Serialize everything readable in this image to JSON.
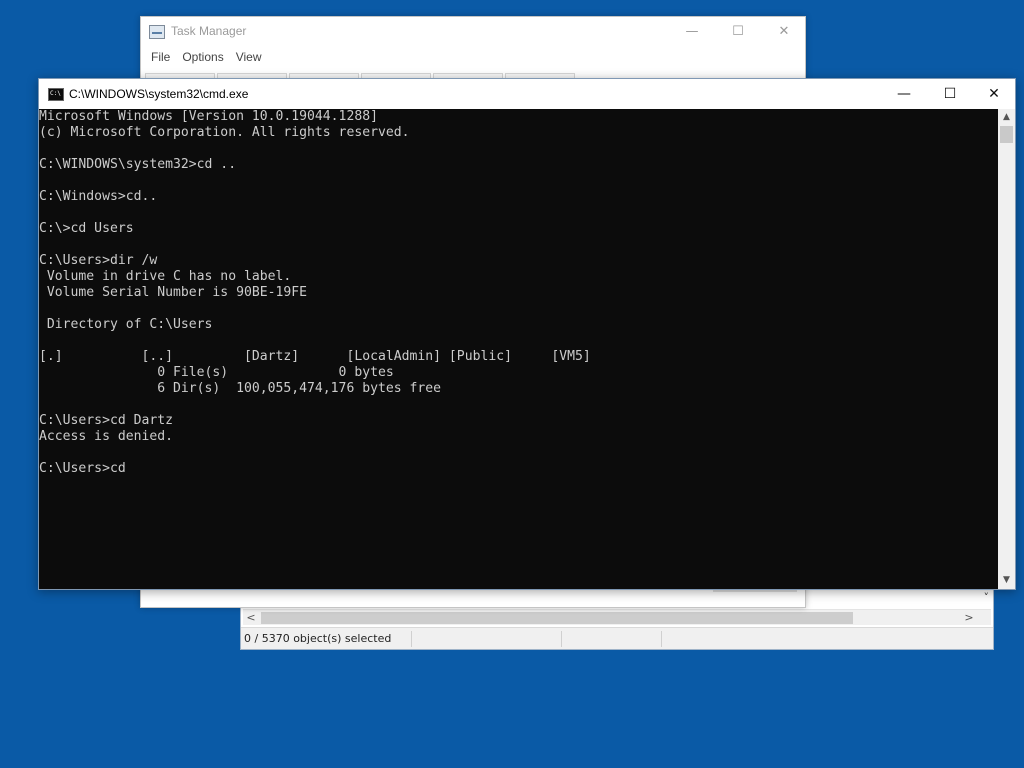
{
  "explorer": {
    "status_text": "0 / 5370 object(s) selected",
    "scroll_left": "<",
    "scroll_right": ">",
    "chevron": "˅"
  },
  "taskmgr": {
    "title": "Task Manager",
    "menu": [
      "File",
      "Options",
      "View"
    ],
    "controls": {
      "minimize": "—",
      "maximize": "☐",
      "close": "✕"
    }
  },
  "cmd": {
    "title": "C:\\WINDOWS\\system32\\cmd.exe",
    "controls": {
      "minimize": "—",
      "maximize": "☐",
      "close": "✕"
    },
    "lines": [
      "Microsoft Windows [Version 10.0.19044.1288]",
      "(c) Microsoft Corporation. All rights reserved.",
      "",
      "C:\\WINDOWS\\system32>cd ..",
      "",
      "C:\\Windows>cd..",
      "",
      "C:\\>cd Users",
      "",
      "C:\\Users>dir /w",
      " Volume in drive C has no label.",
      " Volume Serial Number is 90BE-19FE",
      "",
      " Directory of C:\\Users",
      "",
      "[.]          [..]         [Dartz]      [LocalAdmin] [Public]     [VM5]",
      "               0 File(s)              0 bytes",
      "               6 Dir(s)  100,055,474,176 bytes free",
      "",
      "C:\\Users>cd Dartz",
      "Access is denied.",
      "",
      "C:\\Users>cd"
    ],
    "scroll_up": "▲",
    "scroll_down": "▼"
  }
}
